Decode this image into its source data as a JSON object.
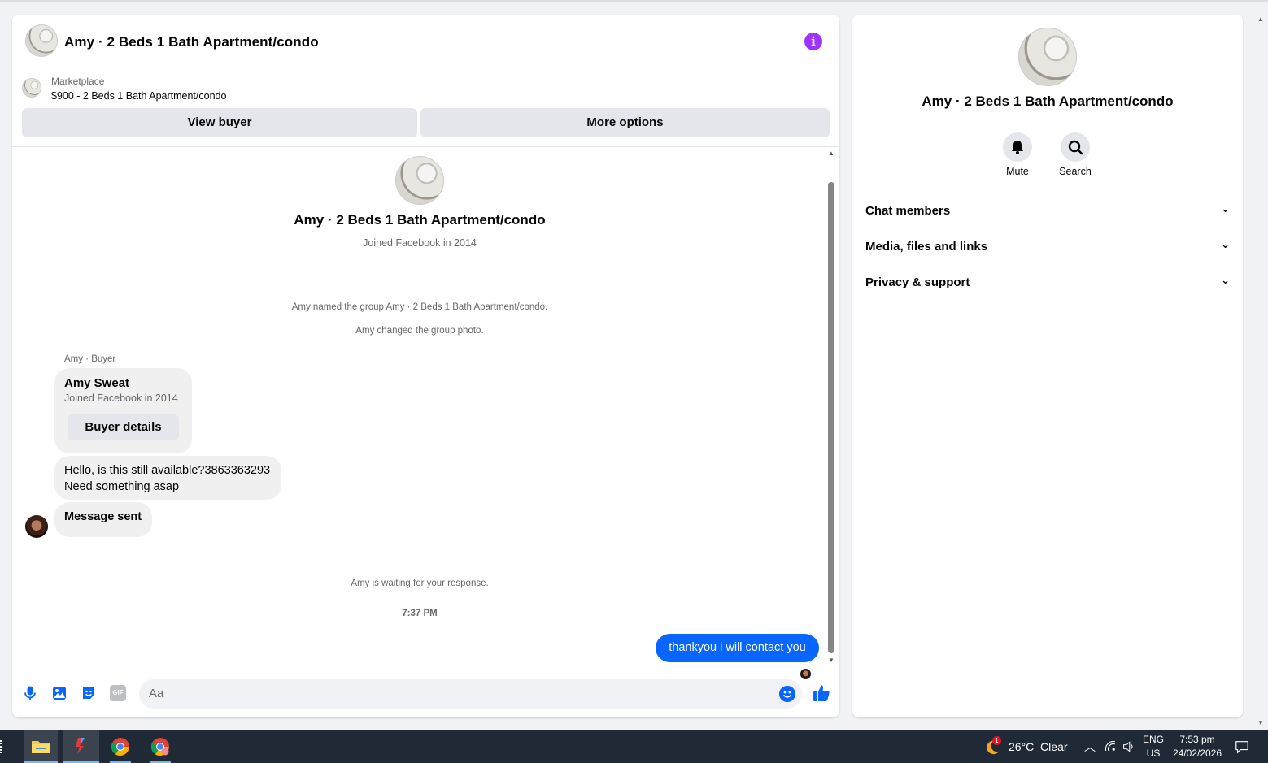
{
  "conversation": {
    "title": "Amy · 2 Beds 1 Bath Apartment/condo",
    "marketplace": {
      "kicker": "Marketplace",
      "listing": "$900 - 2 Beds 1 Bath Apartment/condo",
      "view_buyer_label": "View buyer",
      "more_options_label": "More options"
    },
    "intro": {
      "name": "Amy · 2 Beds 1 Bath Apartment/condo",
      "joined": "Joined Facebook in 2014"
    },
    "system_messages": [
      "Amy named the group Amy · 2 Beds 1 Bath Apartment/condo.",
      "Amy changed the group photo."
    ],
    "buyer_card": {
      "sender_label": "Amy · Buyer",
      "name": "Amy Sweat",
      "joined": "Joined Facebook in 2014",
      "button_label": "Buyer details"
    },
    "incoming_messages": [
      {
        "lines": [
          "Hello, is this still available?3863363293",
          "Need something asap"
        ]
      },
      {
        "lines": [
          "Message sent"
        ]
      }
    ],
    "waiting_text": "Amy is waiting for your response.",
    "timestamp": "7:37 PM",
    "outgoing_message": "thankyou i will contact you",
    "composer": {
      "placeholder": "Aa",
      "icons": [
        "microphone-icon",
        "photo-icon",
        "sticker-icon",
        "gif-icon",
        "emoji-icon",
        "like-icon"
      ],
      "gif_label": "GIF",
      "accent": "#0866ff"
    }
  },
  "info_panel": {
    "name": "Amy · 2 Beds 1 Bath Apartment/condo",
    "actions": [
      {
        "label": "Mute",
        "icon": "bell-icon"
      },
      {
        "label": "Search",
        "icon": "search-icon"
      }
    ],
    "sections": [
      {
        "label": "Chat members"
      },
      {
        "label": "Media, files and links"
      },
      {
        "label": "Privacy & support"
      }
    ]
  },
  "taskbar": {
    "weather_badge": "1",
    "weather": "26°C  Clear",
    "language_top": "ENG",
    "language_bottom": "US",
    "time": "7:53 pm",
    "date": "24/02/2026",
    "apps": [
      "file-explorer-icon",
      "app-icon",
      "chrome-icon",
      "chrome-icon"
    ]
  },
  "colors": {
    "accent": "#0866ff",
    "info_icon": "#a033ff",
    "taskbar": "#1f2a36"
  }
}
